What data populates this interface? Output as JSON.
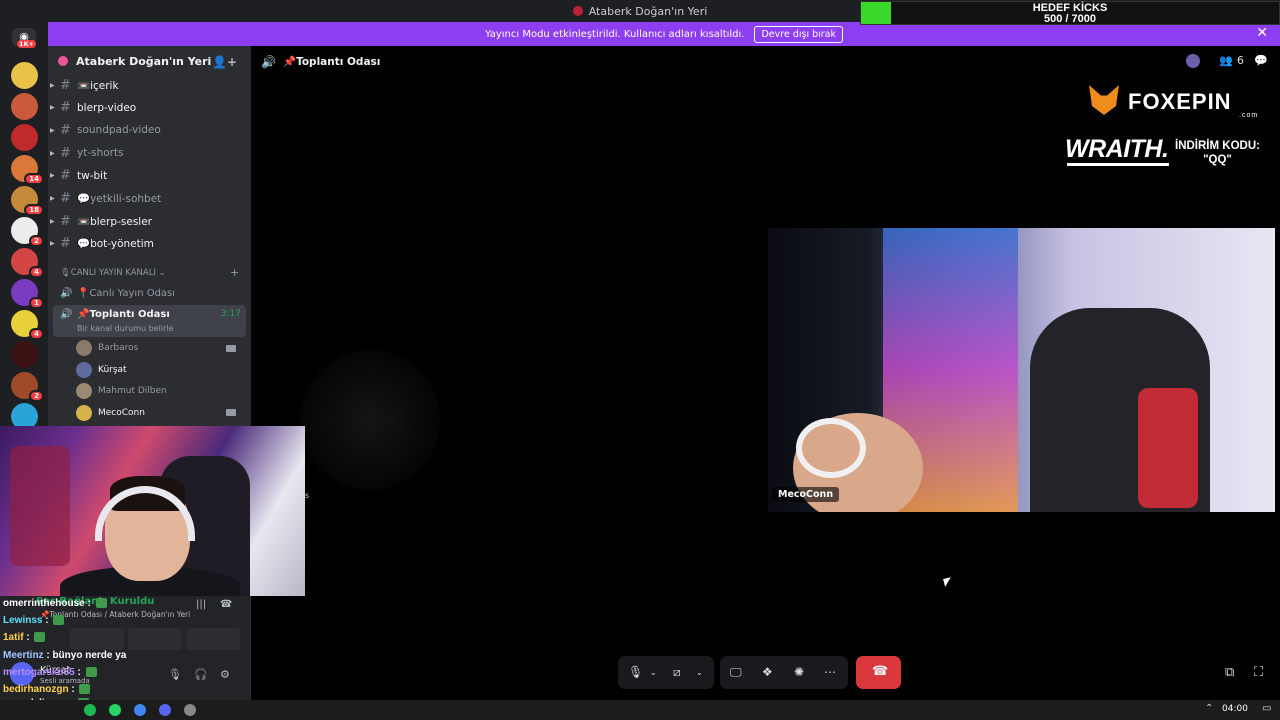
{
  "window": {
    "title": "Ataberk Doğan'ın Yeri"
  },
  "goal": {
    "label": "HEDEF KİCKS",
    "count": "500 / 7000",
    "progress": 0.0714,
    "color": "#39d92b"
  },
  "banner": {
    "text": "Yayıncı Modu etkinleştirildi. Kullanıcı adları kısaltıldı.",
    "button": "Devre dışı bırak",
    "close_icon": "close-icon",
    "color": "#8d3ef0"
  },
  "server_rail": {
    "badge_top": "1K+",
    "servers": [
      {
        "badge": ""
      },
      {
        "badge": ""
      },
      {
        "badge": ""
      },
      {
        "badge": "14"
      },
      {
        "badge": "18"
      },
      {
        "badge": "2"
      },
      {
        "badge": "4"
      },
      {
        "badge": "1"
      },
      {
        "badge": "4"
      },
      {
        "badge": ""
      },
      {
        "badge": "2"
      },
      {
        "badge": ""
      }
    ]
  },
  "guild": {
    "name": "Ataberk Doğan'ın Yeri",
    "chevron": "chevron-down-icon",
    "add_member_icon": "add-user-icon"
  },
  "text_channels": [
    {
      "name": "📼içerik",
      "bright": true
    },
    {
      "name": "blerp-video",
      "bright": true
    },
    {
      "name": "soundpad-video",
      "bright": false
    },
    {
      "name": "yt-shorts",
      "bright": false
    },
    {
      "name": "tw-bit",
      "bright": true
    },
    {
      "name": "💬yetkili-sohbet",
      "bright": false
    },
    {
      "name": "📼blerp-sesler",
      "bright": true
    },
    {
      "name": "💬bot-yönetim",
      "bright": true
    }
  ],
  "category": {
    "name": "🎙CANLI YAYIN KANALI",
    "plus": "+"
  },
  "voice_channels": [
    {
      "name": "📍Canlı Yayın Odası"
    },
    {
      "name": "📌Toplantı Odası",
      "timer": "3:17",
      "sub": "Bir kanal durumu belirle"
    }
  ],
  "voice_users": [
    {
      "name": "Barbaros",
      "camera": true
    },
    {
      "name": "Kürşat",
      "camera": false
    },
    {
      "name": "Mahmut Dilben",
      "camera": false
    },
    {
      "name": "MecoConn",
      "camera": true
    }
  ],
  "voice_panel": {
    "status": "Ses Bağlantı Kuruldu",
    "location": "📌Toplantı Odası / Ataberk Doğan'ın Yeri",
    "user": "Kürşat",
    "user_status": "Sesli aramada"
  },
  "chat": [
    {
      "nick": "omerrinthehouse",
      "msg": ""
    },
    {
      "nick": "Lewinss",
      "msg": ""
    },
    {
      "nick": "1atif",
      "msg": ""
    },
    {
      "nick": "Meertinz",
      "msg": "bünyo nerde ya"
    },
    {
      "nick": "mertogarsko35",
      "msg": ""
    },
    {
      "nick": "bedirhanozgn",
      "msg": ""
    },
    {
      "nick": "muradaliyevv",
      "msg": ""
    }
  ],
  "header": {
    "channel": "📌Toplantı Odası",
    "participants": "6"
  },
  "overlay": {
    "brand": "FOXEPIN",
    "brand_sub": ".com",
    "partner": "WRAITH.",
    "promo_line1": "İNDİRİM KODU:",
    "promo_line2": "\"QQ\""
  },
  "tile": {
    "name": "MecoConn"
  },
  "ghost_letter": "s",
  "taskbar": {
    "time": "04:00"
  }
}
